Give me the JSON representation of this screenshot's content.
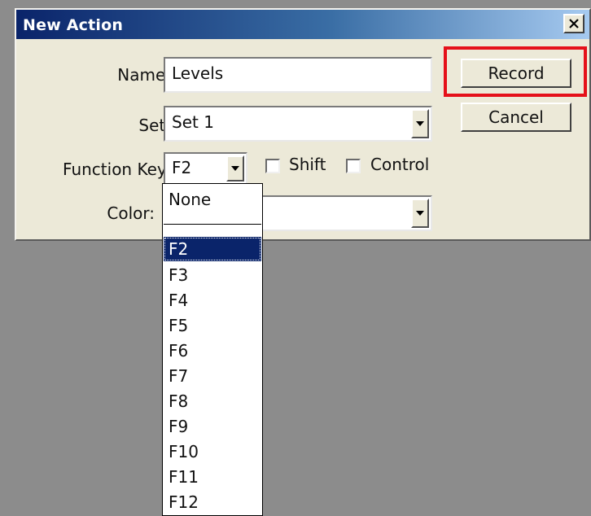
{
  "dialog": {
    "title": "New Action",
    "close_glyph": "x",
    "fields": {
      "name_label": "Name:",
      "name_value": "Levels",
      "set_label": "Set:",
      "set_value": "Set 1",
      "function_key_label": "Function Key:",
      "function_key_value": "F2",
      "color_label": "Color:",
      "color_value": ""
    },
    "modifiers": {
      "shift_label": "Shift",
      "shift_checked": false,
      "control_label": "Control",
      "control_checked": false
    },
    "buttons": {
      "record_label": "Record",
      "cancel_label": "Cancel"
    },
    "highlight_color": "#e5101a"
  },
  "function_key_dropdown": {
    "options": [
      "None",
      "",
      "F2",
      "F3",
      "F4",
      "F5",
      "F6",
      "F7",
      "F8",
      "F9",
      "F10",
      "F11",
      "F12"
    ],
    "selected": "F2"
  },
  "icons": {
    "close": "close-icon",
    "dropdown_arrow": "dropdown-arrow-icon"
  },
  "colors": {
    "background": "#8c8c8c",
    "dialog_face": "#ece9d8",
    "title_bar_start": "#0a246a",
    "selection": "#0a246a"
  }
}
